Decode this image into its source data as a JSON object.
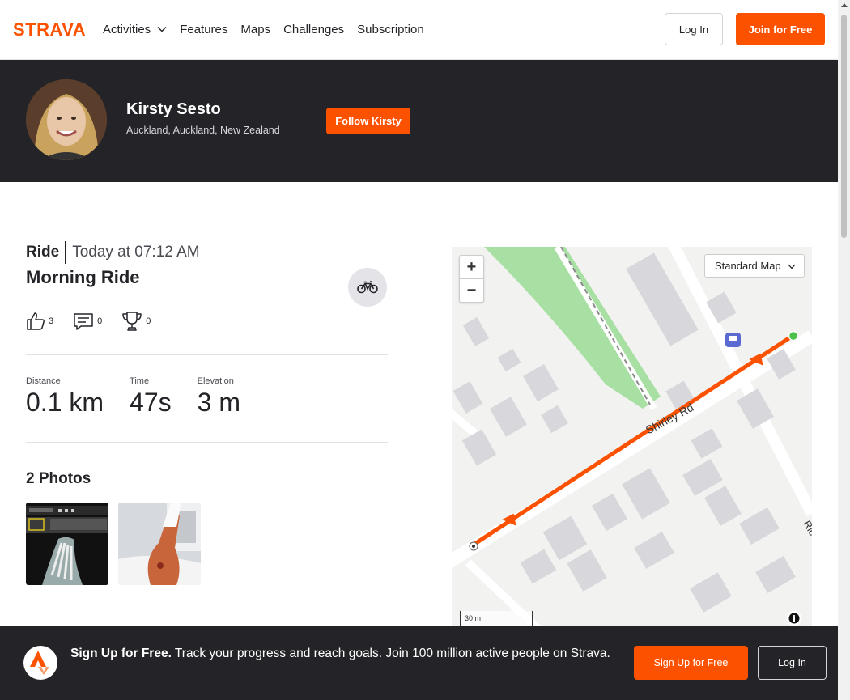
{
  "brand": {
    "name": "STRAVA",
    "accent": "#fc5200",
    "dark": "#242428"
  },
  "nav": {
    "links": [
      {
        "label": "Activities",
        "has_dropdown": true
      },
      {
        "label": "Features"
      },
      {
        "label": "Maps"
      },
      {
        "label": "Challenges"
      },
      {
        "label": "Subscription"
      }
    ],
    "login_label": "Log In",
    "join_label": "Join for Free"
  },
  "athlete": {
    "name": "Kirsty Sesto",
    "location": "Auckland, Auckland, New Zealand",
    "follow_label": "Follow Kirsty"
  },
  "activity": {
    "type": "Ride",
    "date": "Today at 07:12 AM",
    "title": "Morning Ride",
    "sport_icon": "bike-icon",
    "kudos": "3",
    "comments": "0",
    "achievements": "0",
    "stats": [
      {
        "label": "Distance",
        "value": "0.1 km"
      },
      {
        "label": "Time",
        "value": "47s"
      },
      {
        "label": "Elevation",
        "value": "3 m"
      }
    ],
    "photos_title": "2 Photos"
  },
  "map": {
    "zoom_in": "+",
    "zoom_out": "−",
    "style_select": "Standard Map",
    "road_label": "Shirley Rd",
    "road_label_2": "Ric",
    "scale_label": "30 m"
  },
  "signup": {
    "headline": "Sign Up for Free.",
    "body": " Track your progress and reach goals. Join 100 million active people on Strava.",
    "signup_label": "Sign Up for Free",
    "login_label": "Log In"
  }
}
